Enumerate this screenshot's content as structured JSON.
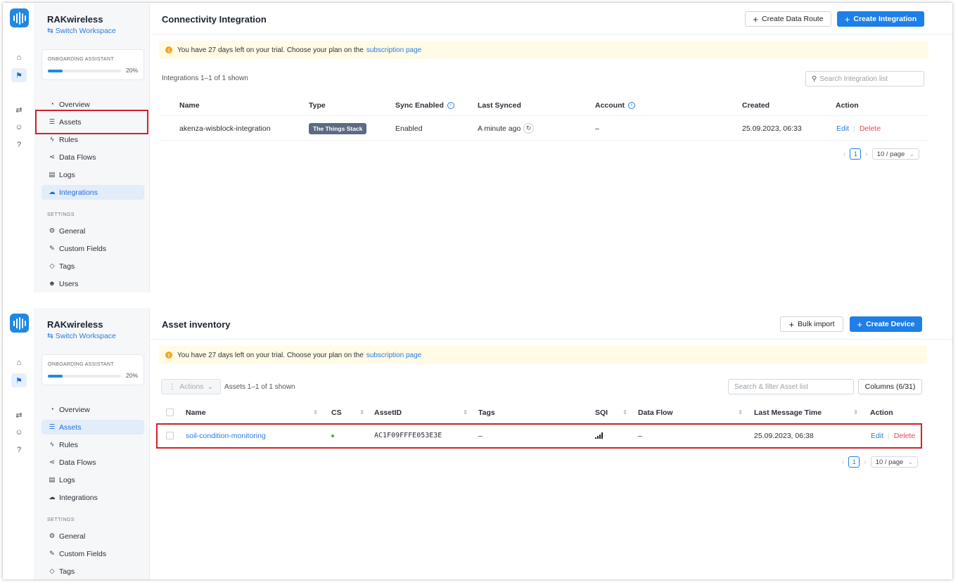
{
  "brand": "RAKwireless",
  "switch_workspace": "Switch Workspace",
  "onboarding": {
    "label": "ONBOARDING ASSISTANT",
    "percent_text": "20%",
    "progress": 0.2
  },
  "nav": {
    "overview": "Overview",
    "assets": "Assets",
    "rules": "Rules",
    "data_flows": "Data Flows",
    "logs": "Logs",
    "integrations": "Integrations",
    "settings_header": "SETTINGS",
    "general": "General",
    "custom_fields": "Custom Fields",
    "tags": "Tags",
    "users": "Users"
  },
  "trial": {
    "text": "You have 27 days left on your trial. Choose your plan on the",
    "link": "subscription page"
  },
  "connectivity": {
    "title": "Connectivity Integration",
    "create_route": "Create Data Route",
    "create_integration": "Create Integration",
    "count": "Integrations 1–1 of 1 shown",
    "search_placeholder": "Search Integration list",
    "columns": {
      "name": "Name",
      "type": "Type",
      "sync": "Sync Enabled",
      "last_synced": "Last Synced",
      "account": "Account",
      "created": "Created",
      "action": "Action"
    },
    "row": {
      "name": "akenza-wisblock-integration",
      "type": "The Things Stack",
      "sync": "Enabled",
      "last_synced": "A minute ago",
      "account": "–",
      "created": "25.09.2023, 06:33",
      "edit": "Edit",
      "delete": "Delete"
    },
    "pager": {
      "page": "1",
      "size": "10 / page"
    }
  },
  "assets": {
    "title": "Asset inventory",
    "bulk_import": "Bulk import",
    "create_device": "Create Device",
    "actions": "Actions",
    "count": "Assets 1–1 of 1 shown",
    "search_placeholder": "Search & filter Asset list",
    "columns_btn": "Columns (6/31)",
    "columns": {
      "name": "Name",
      "cs": "CS",
      "asset_id": "AssetID",
      "tags": "Tags",
      "sqi": "SQI",
      "data_flow": "Data Flow",
      "last_msg": "Last Message Time",
      "action": "Action"
    },
    "row": {
      "name": "soil-condition-monitoring",
      "asset_id": "AC1F09FFFE053E3E",
      "tags": "–",
      "data_flow": "–",
      "last_msg": "25.09.2023, 06:38",
      "edit": "Edit",
      "delete": "Delete"
    },
    "pager": {
      "page": "1",
      "size": "10 / page"
    }
  },
  "colors": {
    "accent": "#1e7fe6",
    "highlight": "#d0232a",
    "danger": "#e5484d",
    "trial_bg": "#fffbe6"
  }
}
